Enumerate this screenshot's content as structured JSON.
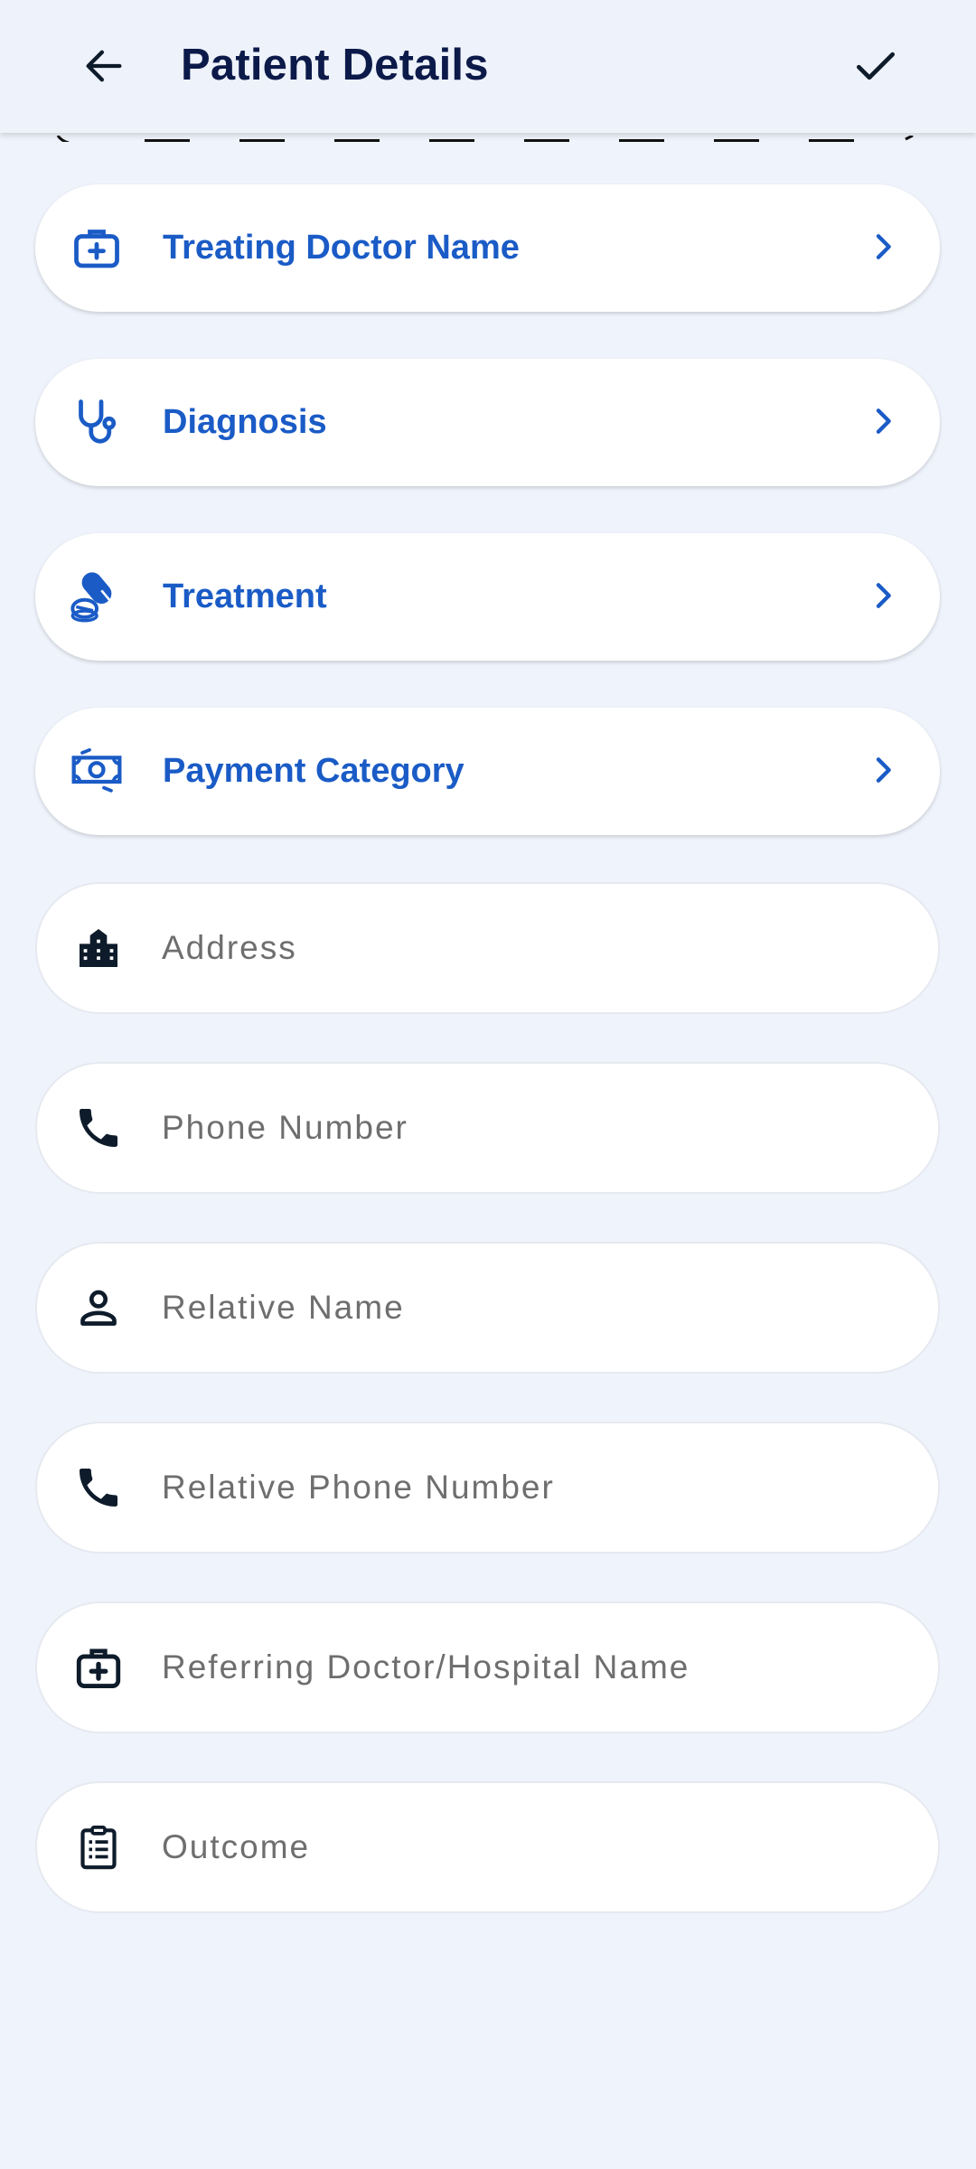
{
  "header": {
    "title": "Patient Details"
  },
  "nav_items": [
    {
      "label": "Treating Doctor Name",
      "icon": "medical-bag-icon"
    },
    {
      "label": "Diagnosis",
      "icon": "stethoscope-icon"
    },
    {
      "label": "Treatment",
      "icon": "pills-icon"
    },
    {
      "label": "Payment Category",
      "icon": "banknote-icon"
    }
  ],
  "fields": [
    {
      "placeholder": "Address",
      "icon": "city-icon"
    },
    {
      "placeholder": "Phone Number",
      "icon": "phone-icon"
    },
    {
      "placeholder": "Relative Name",
      "icon": "person-icon"
    },
    {
      "placeholder": "Relative Phone Number",
      "icon": "phone-icon"
    },
    {
      "placeholder": "Referring Doctor/Hospital Name",
      "icon": "medical-bag-icon"
    },
    {
      "placeholder": "Outcome",
      "icon": "clipboard-list-icon"
    }
  ],
  "colors": {
    "background": "#eff3fb",
    "title": "#0c1a4a",
    "accent": "#1a5bc6",
    "icon_dark": "#0d1b2a",
    "placeholder": "#6e6e6e"
  }
}
